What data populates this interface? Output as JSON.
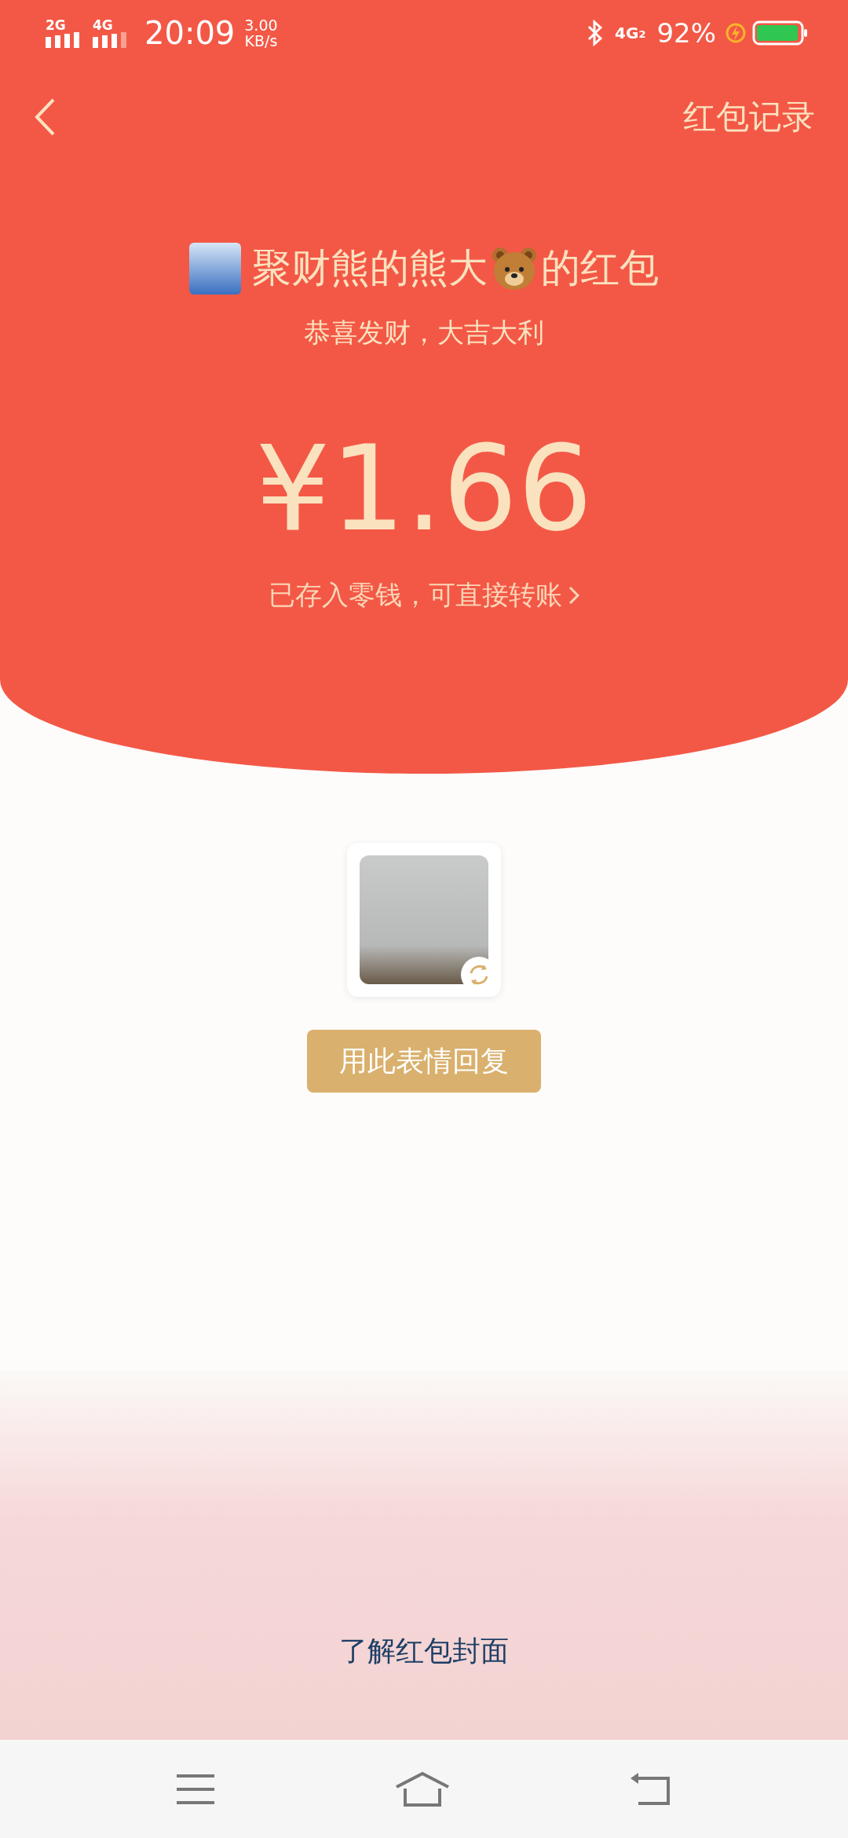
{
  "status_bar": {
    "sim1": "2G",
    "sim2": "4G",
    "time": "20:09",
    "speed_value": "3.00",
    "speed_unit": "KB/s",
    "network": "4G",
    "network_sim": "2",
    "battery": "92%"
  },
  "nav": {
    "records_link": "红包记录"
  },
  "packet": {
    "sender_before": "聚财熊的熊大",
    "sender_after": "的红包",
    "greeting": "恭喜发财，大吉大利",
    "amount": "¥1.66",
    "note": "已存入零钱，可直接转账"
  },
  "reply_button": "用此表情回复",
  "cover_link": "了解红包封面"
}
